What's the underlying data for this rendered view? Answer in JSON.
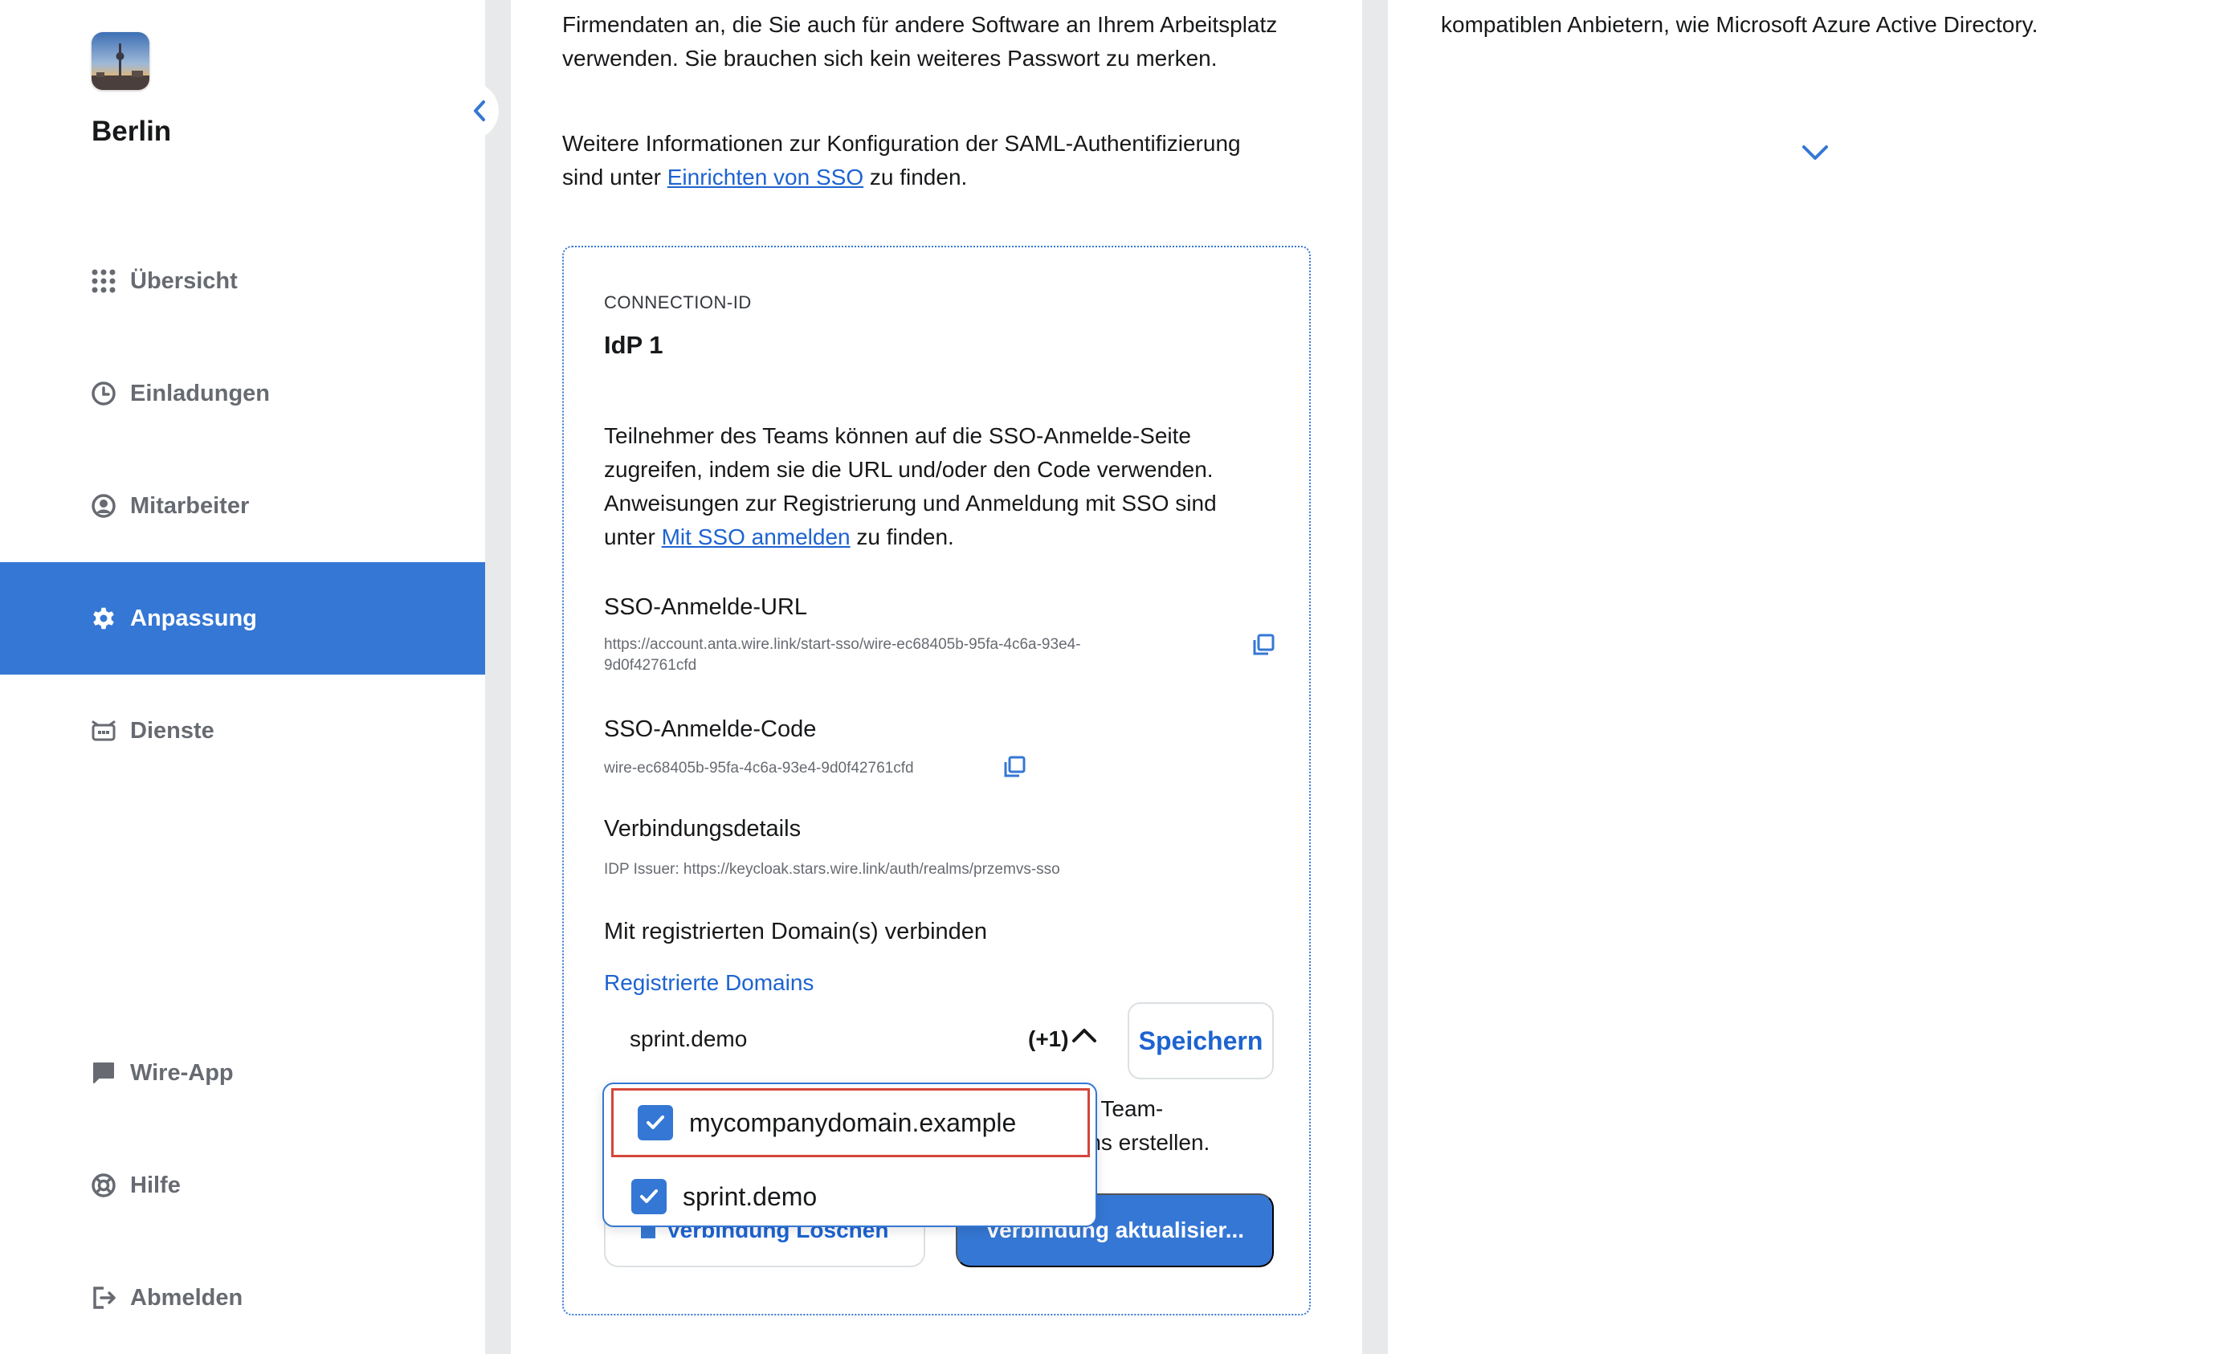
{
  "team": {
    "name": "Berlin"
  },
  "sidebar": {
    "items": [
      {
        "label": "Übersicht",
        "icon": "grid-icon",
        "active": false
      },
      {
        "label": "Einladungen",
        "icon": "clock-icon",
        "active": false
      },
      {
        "label": "Mitarbeiter",
        "icon": "user-circle-icon",
        "active": false
      },
      {
        "label": "Anpassung",
        "icon": "gear-icon",
        "active": true
      },
      {
        "label": "Dienste",
        "icon": "robot-icon",
        "active": false
      },
      {
        "label": "Wire-App",
        "icon": "chat-icon",
        "active": false
      },
      {
        "label": "Hilfe",
        "icon": "lifebuoy-icon",
        "active": false
      },
      {
        "label": "Abmelden",
        "icon": "logout-icon",
        "active": false
      }
    ]
  },
  "center": {
    "intro_line1": "Firmendaten an, die Sie auch für andere Software an Ihrem Arbeitsplatz",
    "intro_line2": "verwenden. Sie brauchen sich kein weiteres Passwort zu merken.",
    "info_prefix": "Weitere Informationen zur Konfiguration der SAML-Authentifizierung",
    "info_line2_prefix": "sind unter ",
    "info_link": "Einrichten von SSO",
    "info_suffix": " zu finden.",
    "idp": {
      "connection_label": "CONNECTION-ID",
      "connection_value": "IdP 1",
      "desc_line1": "Teilnehmer des Teams können auf die SSO-Anmelde-Seite",
      "desc_line2": "zugreifen, indem sie die URL und/oder den Code verwenden.",
      "desc_line3": "Anweisungen zur Registrierung und Anmeldung mit SSO sind",
      "desc_line4_prefix": "unter ",
      "desc_link": "Mit SSO anmelden",
      "desc_line4_suffix": " zu finden.",
      "url_label": "SSO-Anmelde-URL",
      "url_line1": "https://account.anta.wire.link/start-sso/wire-ec68405b-95fa-4c6a-93e4-",
      "url_line2": "9d0f42761cfd",
      "code_label": "SSO-Anmelde-Code",
      "code_value": "wire-ec68405b-95fa-4c6a-93e4-9d0f42761cfd",
      "details_label": "Verbindungsdetails",
      "details_value": "IDP Issuer: https://keycloak.stars.wire.link/auth/realms/przemvs-sso",
      "domains_label": "Mit registrierten Domain(s) verbinden",
      "registered_domains_link": "Registrierte Domains",
      "selected_domain": "sprint.demo",
      "selected_extra": "(+1)",
      "save_label": "Speichern",
      "partial_line1": "en Team-",
      "partial_line2": "ams erstellen.",
      "delete_label": "Verbindung Löschen",
      "update_label": "Verbindung aktualisier..."
    }
  },
  "dropdown": {
    "options": [
      {
        "label": "mycompanydomain.example",
        "checked": true
      },
      {
        "label": "sprint.demo",
        "checked": true
      }
    ]
  },
  "right": {
    "text": "kompatiblen Anbietern, wie Microsoft Azure Active Directory."
  },
  "colors": {
    "accent": "#3577d4",
    "link": "#1d63d1",
    "highlight": "#d4463b"
  }
}
